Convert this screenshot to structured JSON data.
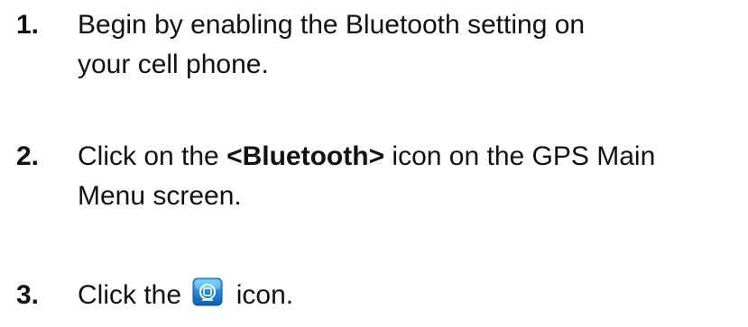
{
  "steps": [
    {
      "number": "1.",
      "line1": "Begin by enabling the Bluetooth setting on",
      "line2": "your cell phone."
    },
    {
      "number": "2.",
      "line1_prefix": "Click on the ",
      "line1_bold": "<Bluetooth>",
      "line1_suffix": " icon on the GPS Main",
      "line2": "Menu screen."
    },
    {
      "number": "3.",
      "prefix": "Click the",
      "icon": "bluetooth-search-icon",
      "suffix": "icon."
    }
  ]
}
